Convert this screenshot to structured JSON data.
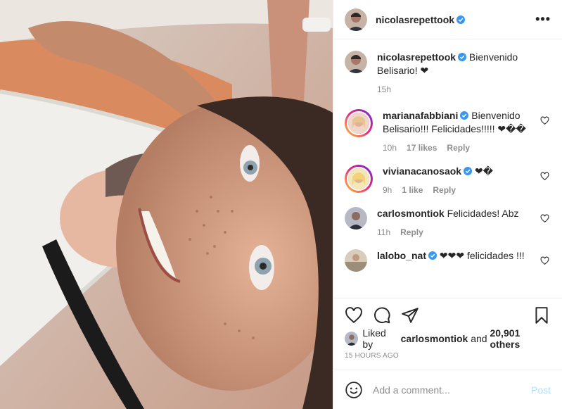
{
  "header": {
    "username": "nicolasrepettook",
    "more_label": "•••"
  },
  "caption": {
    "username": "nicolasrepettook",
    "text": "Bienvenido Belisario! ❤",
    "time": "15h"
  },
  "comments": [
    {
      "username": "marianafabbiani",
      "verified": true,
      "text": "Bienvenido Belisario!!! Felicidades!!!!! ❤��",
      "time": "10h",
      "likes": "17 likes",
      "reply": "Reply"
    },
    {
      "username": "vivianacanosaok",
      "verified": true,
      "text": "❤�",
      "time": "9h",
      "likes": "1 like",
      "reply": "Reply"
    },
    {
      "username": "carlosmontiok",
      "verified": false,
      "text": "Felicidades! Abz",
      "time": "11h",
      "likes": "",
      "reply": "Reply"
    },
    {
      "username": "lalobo_nat",
      "verified": true,
      "text": "❤❤❤ felicidades !!!",
      "time": "",
      "likes": "",
      "reply": ""
    }
  ],
  "likes": {
    "prefix": "Liked by",
    "user": "carlosmontiok",
    "middle": "and",
    "others": "20,901 others"
  },
  "timestamp": "15 HOURS AGO",
  "add_comment": {
    "placeholder": "Add a comment...",
    "post_label": "Post"
  },
  "icons": {
    "verified": "verified-badge-icon",
    "like": "heart-icon",
    "comment": "comment-bubble-icon",
    "share": "paper-plane-icon",
    "save": "bookmark-icon",
    "emoji": "smiley-icon"
  },
  "colors": {
    "verified": "#3897f0",
    "post_button_disabled": "#b2dffc",
    "muted": "#8e8e8e",
    "text": "#262626"
  }
}
